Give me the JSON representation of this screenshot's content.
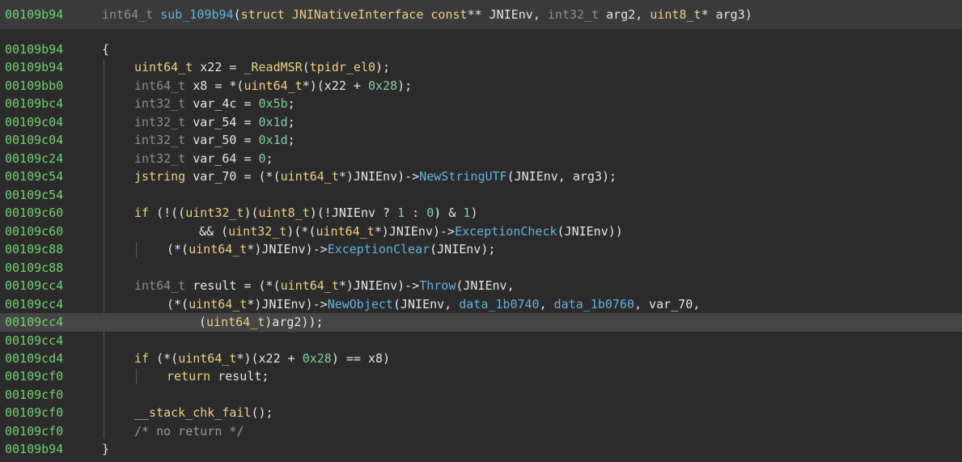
{
  "header": {
    "address": "00109b94",
    "tokens": [
      {
        "t": "int64_t ",
        "s": "t"
      },
      {
        "t": "sub_109b94",
        "s": "f"
      },
      {
        "t": "(",
        "s": ""
      },
      {
        "t": "struct JNINativeInterface const",
        "s": "k"
      },
      {
        "t": "** JNIEnv, ",
        "s": ""
      },
      {
        "t": "int32_t ",
        "s": "t"
      },
      {
        "t": "arg2, ",
        "s": ""
      },
      {
        "t": "uint8_t",
        "s": "k"
      },
      {
        "t": "* arg3)",
        "s": ""
      }
    ]
  },
  "lines": [
    {
      "addr": "00109b94",
      "indent": 0,
      "tokens": [
        {
          "t": "{",
          "s": ""
        }
      ]
    },
    {
      "addr": "00109b94",
      "indent": 1,
      "tokens": [
        {
          "t": "uint64_t",
          "s": "k"
        },
        {
          "t": " x22 = ",
          "s": ""
        },
        {
          "t": "_ReadMSR",
          "s": "k"
        },
        {
          "t": "(",
          "s": ""
        },
        {
          "t": "tpidr_el0",
          "s": "k"
        },
        {
          "t": ");",
          "s": ""
        }
      ]
    },
    {
      "addr": "00109bb0",
      "indent": 1,
      "tokens": [
        {
          "t": "int64_t",
          "s": "t"
        },
        {
          "t": " x8 = *(",
          "s": ""
        },
        {
          "t": "uint64_t",
          "s": "k"
        },
        {
          "t": "*)(x22 + ",
          "s": ""
        },
        {
          "t": "0x28",
          "s": "n"
        },
        {
          "t": ");",
          "s": ""
        }
      ]
    },
    {
      "addr": "00109bc4",
      "indent": 1,
      "tokens": [
        {
          "t": "int32_t",
          "s": "t"
        },
        {
          "t": " var_4c = ",
          "s": ""
        },
        {
          "t": "0x5b",
          "s": "n"
        },
        {
          "t": ";",
          "s": ""
        }
      ]
    },
    {
      "addr": "00109c04",
      "indent": 1,
      "tokens": [
        {
          "t": "int32_t",
          "s": "t"
        },
        {
          "t": " var_54 = ",
          "s": ""
        },
        {
          "t": "0x1d",
          "s": "n"
        },
        {
          "t": ";",
          "s": ""
        }
      ]
    },
    {
      "addr": "00109c04",
      "indent": 1,
      "tokens": [
        {
          "t": "int32_t",
          "s": "t"
        },
        {
          "t": " var_50 = ",
          "s": ""
        },
        {
          "t": "0x1d",
          "s": "n"
        },
        {
          "t": ";",
          "s": ""
        }
      ]
    },
    {
      "addr": "00109c24",
      "indent": 1,
      "tokens": [
        {
          "t": "int32_t",
          "s": "t"
        },
        {
          "t": " var_64 = ",
          "s": ""
        },
        {
          "t": "0",
          "s": "n"
        },
        {
          "t": ";",
          "s": ""
        }
      ]
    },
    {
      "addr": "00109c54",
      "indent": 1,
      "tokens": [
        {
          "t": "jstring",
          "s": "k"
        },
        {
          "t": " var_70 = (*(",
          "s": ""
        },
        {
          "t": "uint64_t",
          "s": "k"
        },
        {
          "t": "*)JNIEnv)->",
          "s": ""
        },
        {
          "t": "NewStringUTF",
          "s": "f"
        },
        {
          "t": "(JNIEnv, arg3);",
          "s": ""
        }
      ]
    },
    {
      "addr": "00109c54",
      "indent": 1,
      "tokens": []
    },
    {
      "addr": "00109c60",
      "indent": 1,
      "tokens": [
        {
          "t": "if",
          "s": "k"
        },
        {
          "t": " (!((",
          "s": ""
        },
        {
          "t": "uint32_t",
          "s": "k"
        },
        {
          "t": ")(",
          "s": ""
        },
        {
          "t": "uint8_t",
          "s": "k"
        },
        {
          "t": ")(!JNIEnv ? ",
          "s": ""
        },
        {
          "t": "1",
          "s": "n"
        },
        {
          "t": " : ",
          "s": ""
        },
        {
          "t": "0",
          "s": "n"
        },
        {
          "t": ") & ",
          "s": ""
        },
        {
          "t": "1",
          "s": "n"
        },
        {
          "t": ")",
          "s": ""
        }
      ]
    },
    {
      "addr": "00109c60",
      "indent": 3,
      "tokens": [
        {
          "t": "&& (",
          "s": ""
        },
        {
          "t": "uint32_t",
          "s": "k"
        },
        {
          "t": ")(*(",
          "s": ""
        },
        {
          "t": "uint64_t",
          "s": "k"
        },
        {
          "t": "*)JNIEnv)->",
          "s": ""
        },
        {
          "t": "ExceptionCheck",
          "s": "f"
        },
        {
          "t": "(JNIEnv))",
          "s": ""
        }
      ]
    },
    {
      "addr": "00109c88",
      "indent": 2,
      "tokens": [
        {
          "t": "(*(",
          "s": ""
        },
        {
          "t": "uint64_t",
          "s": "k"
        },
        {
          "t": "*)JNIEnv)->",
          "s": ""
        },
        {
          "t": "ExceptionClear",
          "s": "f"
        },
        {
          "t": "(JNIEnv);",
          "s": ""
        }
      ]
    },
    {
      "addr": "00109c88",
      "indent": 1,
      "tokens": []
    },
    {
      "addr": "00109cc4",
      "indent": 1,
      "tokens": [
        {
          "t": "int64_t",
          "s": "t"
        },
        {
          "t": " result = (*(",
          "s": ""
        },
        {
          "t": "uint64_t",
          "s": "k"
        },
        {
          "t": "*)JNIEnv)->",
          "s": ""
        },
        {
          "t": "Throw",
          "s": "f"
        },
        {
          "t": "(JNIEnv,",
          "s": ""
        }
      ]
    },
    {
      "addr": "00109cc4",
      "indent": 2,
      "tokens": [
        {
          "t": "(*(",
          "s": ""
        },
        {
          "t": "uint64_t",
          "s": "k"
        },
        {
          "t": "*)JNIEnv)->",
          "s": ""
        },
        {
          "t": "NewObject",
          "s": "f"
        },
        {
          "t": "(JNIEnv, ",
          "s": ""
        },
        {
          "t": "data_1b0740",
          "s": "f"
        },
        {
          "t": ", ",
          "s": ""
        },
        {
          "t": "data_1b0760",
          "s": "f"
        },
        {
          "t": ", var_70,",
          "s": ""
        }
      ]
    },
    {
      "addr": "00109cc4",
      "indent": 3,
      "highlight": true,
      "tokens": [
        {
          "t": "(",
          "s": ""
        },
        {
          "t": "uint64_t",
          "s": "k"
        },
        {
          "t": ")arg2));",
          "s": ""
        }
      ]
    },
    {
      "addr": "00109cc4",
      "indent": 1,
      "tokens": []
    },
    {
      "addr": "00109cd4",
      "indent": 1,
      "tokens": [
        {
          "t": "if",
          "s": "k"
        },
        {
          "t": " (*(",
          "s": ""
        },
        {
          "t": "uint64_t",
          "s": "k"
        },
        {
          "t": "*)(x22 + ",
          "s": ""
        },
        {
          "t": "0x28",
          "s": "n"
        },
        {
          "t": ") == x8)",
          "s": ""
        }
      ]
    },
    {
      "addr": "00109cf0",
      "indent": 2,
      "tokens": [
        {
          "t": "return",
          "s": "k"
        },
        {
          "t": " result;",
          "s": ""
        }
      ]
    },
    {
      "addr": "00109cf0",
      "indent": 1,
      "tokens": []
    },
    {
      "addr": "00109cf0",
      "indent": 1,
      "tokens": [
        {
          "t": "__stack_chk_fail",
          "s": "k"
        },
        {
          "t": "();",
          "s": ""
        }
      ]
    },
    {
      "addr": "00109cf0",
      "indent": 1,
      "tokens": [
        {
          "t": "/* no return */",
          "s": "c"
        }
      ]
    },
    {
      "addr": "00109b94",
      "indent": 0,
      "tokens": [
        {
          "t": "}",
          "s": ""
        }
      ]
    }
  ]
}
